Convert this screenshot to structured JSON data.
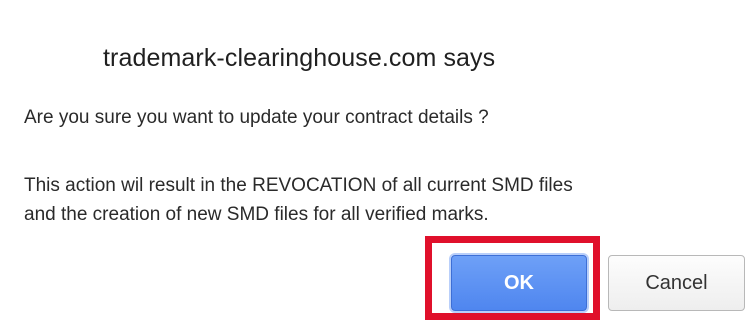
{
  "dialog": {
    "title": "trademark-clearinghouse.com says",
    "question": "Are you sure you want to update your contract details ?",
    "warning_lines": [
      "This action wil result in the REVOCATION of all current SMD files",
      "and the creation of new SMD files for all verified marks."
    ],
    "ok_label": "OK",
    "cancel_label": "Cancel"
  },
  "colors": {
    "ok_button": "#4f86ef",
    "highlight_border": "#e0102b",
    "cancel_button": "#eeeeee"
  }
}
